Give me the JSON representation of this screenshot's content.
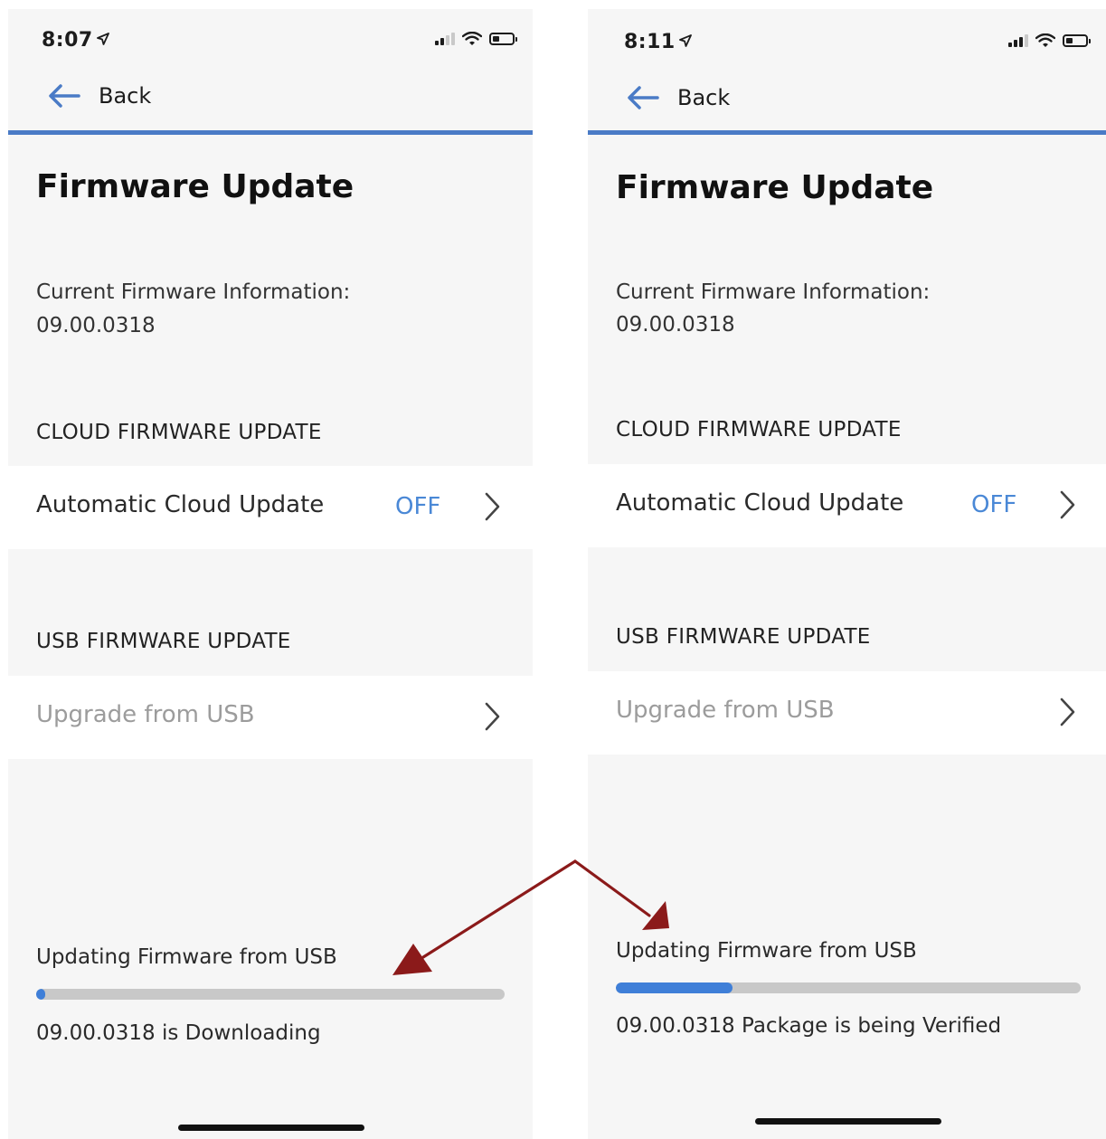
{
  "screens": {
    "left": {
      "time": "8:07",
      "back_label": "Back",
      "title": "Firmware Update",
      "info_label": "Current Firmware Information:",
      "info_value": "09.00.0318",
      "cloud_section": "CLOUD FIRMWARE UPDATE",
      "auto_update_label": "Automatic Cloud Update",
      "auto_update_value": "OFF",
      "usb_section": "USB FIRMWARE UPDATE",
      "usb_label": "Upgrade from USB",
      "progress_label": "Updating Firmware from USB",
      "progress_fraction": 0.02,
      "progress_status": "09.00.0318 is Downloading"
    },
    "right": {
      "time": "8:11",
      "back_label": "Back",
      "title": "Firmware Update",
      "info_label": "Current Firmware Information:",
      "info_value": "09.00.0318",
      "cloud_section": "CLOUD FIRMWARE UPDATE",
      "auto_update_label": "Automatic Cloud Update",
      "auto_update_value": "OFF",
      "usb_section": "USB FIRMWARE UPDATE",
      "usb_label": "Upgrade from USB",
      "progress_label": "Updating Firmware from USB",
      "progress_fraction": 0.25,
      "progress_status": "09.00.0318 Package is being Verified"
    }
  },
  "colors": {
    "accent": "#4a7bc6",
    "progress": "#3f7fd8",
    "off_value": "#4a88d6",
    "annotation_arrow": "#8b1a1a"
  },
  "icons": {
    "back": "arrow-left-icon",
    "chevron": "chevron-right-icon",
    "location": "location-arrow-icon",
    "signal": "cellular-signal-icon",
    "wifi": "wifi-icon",
    "battery": "battery-icon"
  }
}
